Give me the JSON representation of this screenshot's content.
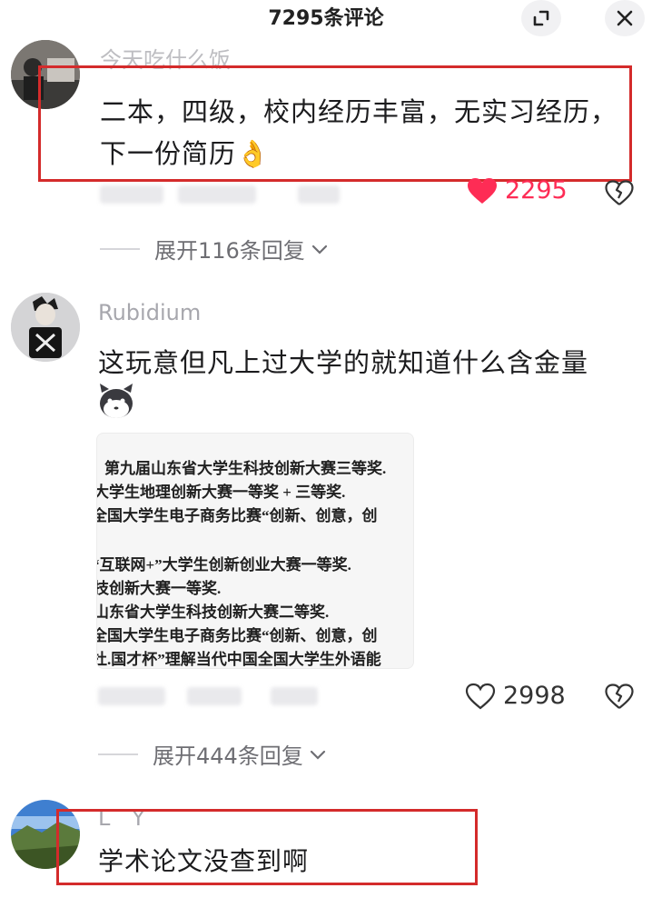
{
  "header": {
    "title": "7295条评论"
  },
  "comments": [
    {
      "username": "今天吃什么饭",
      "text_line1": "二本，四级，校内经历丰富，无实习经历，",
      "text_line2": "下一份简历",
      "emoji": "👌",
      "likes": "2295",
      "replies": "展开116条回复"
    },
    {
      "username": "Rubidium",
      "text": "这玩意但凡上过大学的就知道什么含金量",
      "likes": "2998",
      "replies": "展开444条回复",
      "image_lines": [
        "第九届山东省大学生科技创新大赛三等奖.",
        "大学生地理创新大赛一等奖 + 三等奖.",
        "全国大学生电子商务比赛“创新、创意，创",
        "",
        "“互联网+”大学生创新创业大赛一等奖.",
        "技创新大赛一等奖.",
        "山东省大学生科技创新大赛二等奖.",
        "全国大学生电子商务比赛“创新、创意，创",
        "杜.国才杯”理解当代中国全国大学生外语能"
      ]
    },
    {
      "username": "L Y",
      "text": "学术论文没查到啊"
    }
  ],
  "colors": {
    "accent": "#fe2c55",
    "redbox": "#d42b2b"
  }
}
